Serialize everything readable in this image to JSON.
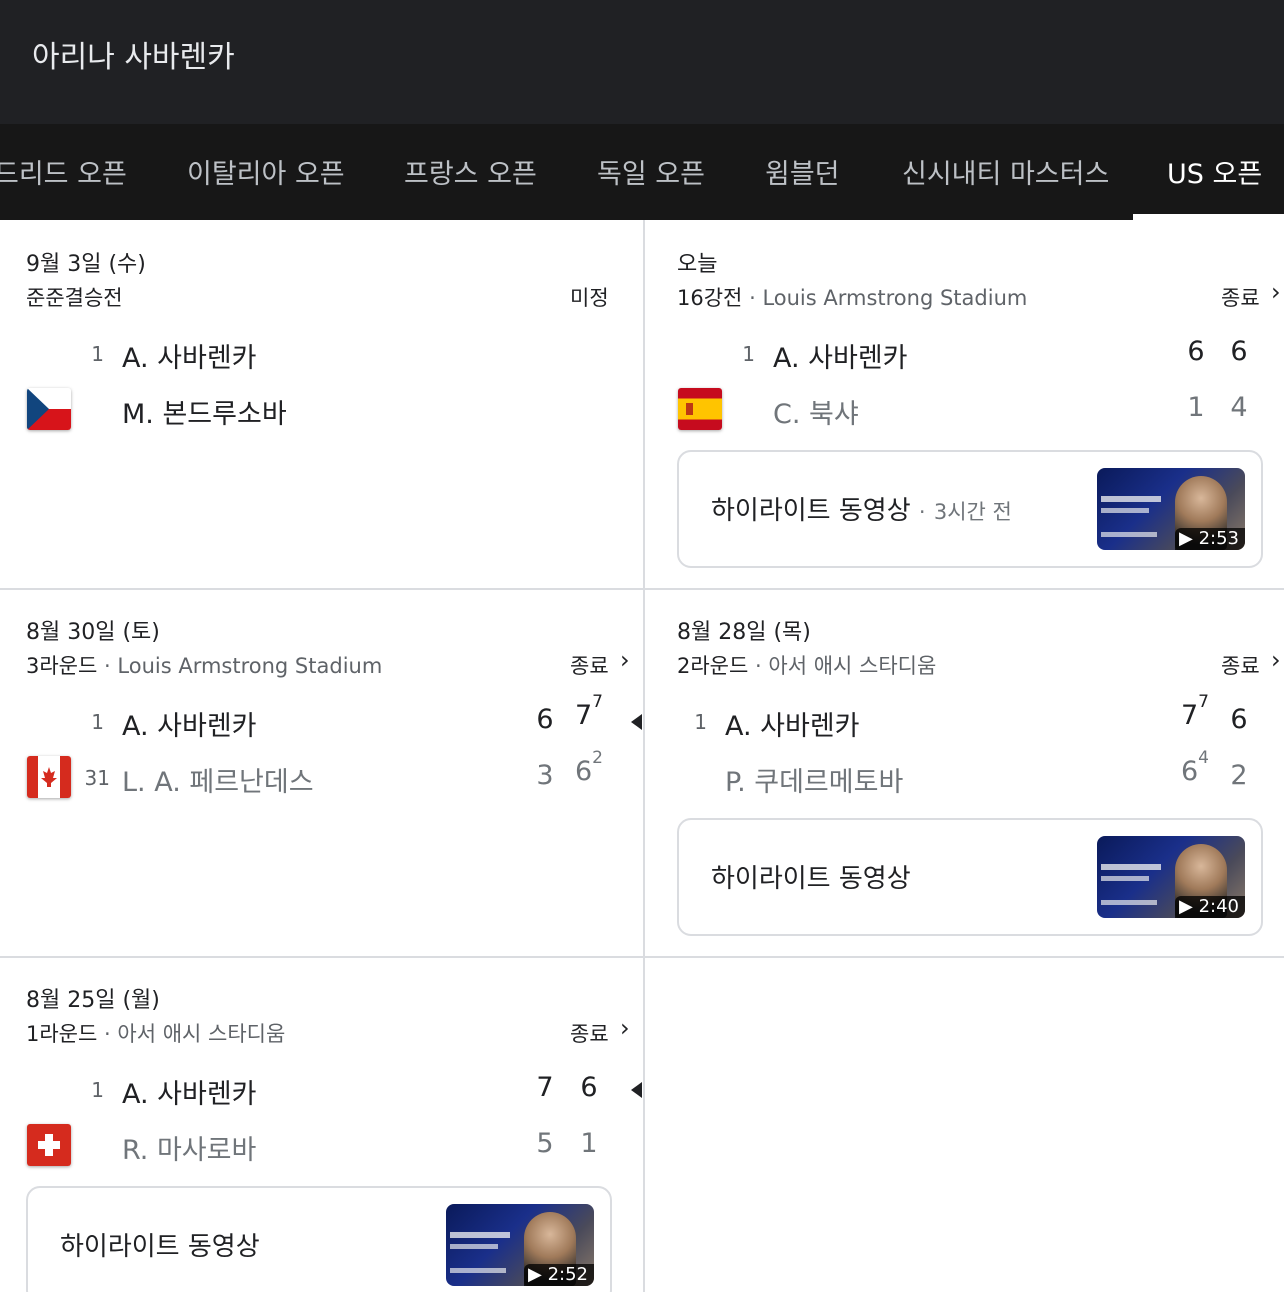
{
  "header": {
    "title": "아리나 사바렌카"
  },
  "tabs": [
    {
      "label": "드리드 오픈"
    },
    {
      "label": "이탈리아 오픈"
    },
    {
      "label": "프랑스 오픈"
    },
    {
      "label": "독일 오픈"
    },
    {
      "label": "윔블던"
    },
    {
      "label": "신시내티 마스터스"
    },
    {
      "label": "US 오픈",
      "active": true
    }
  ],
  "matches": [
    {
      "date": "9월 3일 (수)",
      "round": "준준결승전",
      "venue": "",
      "status": "미정",
      "players": [
        {
          "seed": "1",
          "name": "A. 사바렌카",
          "flag": "",
          "scores": []
        },
        {
          "seed": "",
          "name": "M. 본드루소바",
          "flag": "czech-flag-icon",
          "scores": []
        }
      ]
    },
    {
      "date": "오늘",
      "round": "16강전",
      "venue": "Louis Armstrong Stadium",
      "status": "종료",
      "players": [
        {
          "seed": "1",
          "name": "A. 사바렌카",
          "flag": "",
          "scores": [
            "6",
            "6"
          ]
        },
        {
          "seed": "",
          "name": "C. 북샤",
          "flag": "spain-flag-icon",
          "scores": [
            "1",
            "4"
          ]
        }
      ],
      "highlight": {
        "label": "하이라이트 동영상",
        "time": "3시간 전",
        "duration": "▶ 2:53"
      }
    },
    {
      "date": "8월 30일 (토)",
      "round": "3라운드",
      "venue": "Louis Armstrong Stadium",
      "status": "종료",
      "players": [
        {
          "seed": "1",
          "name": "A. 사바렌카",
          "flag": "",
          "scores": [
            "6",
            "7"
          ],
          "tiebreaks": [
            "",
            "7"
          ]
        },
        {
          "seed": "31",
          "name": "L. A. 페르난데스",
          "flag": "canada-flag-icon",
          "scores": [
            "3",
            "6"
          ],
          "tiebreaks": [
            "",
            "2"
          ]
        }
      ]
    },
    {
      "date": "8월 28일 (목)",
      "round": "2라운드",
      "venue": "아서 애시 스타디움",
      "status": "종료",
      "players": [
        {
          "seed": "1",
          "name": "A. 사바렌카",
          "flag": "",
          "scores": [
            "7",
            "6"
          ],
          "tiebreaks": [
            "7",
            ""
          ]
        },
        {
          "seed": "",
          "name": "P. 쿠데르메토바",
          "flag": "",
          "scores": [
            "6",
            "2"
          ],
          "tiebreaks": [
            "4",
            ""
          ]
        }
      ],
      "highlight": {
        "label": "하이라이트 동영상",
        "time": "",
        "duration": "▶ 2:40"
      }
    },
    {
      "date": "8월 25일 (월)",
      "round": "1라운드",
      "venue": "아서 애시 스타디움",
      "status": "종료",
      "players": [
        {
          "seed": "1",
          "name": "A. 사바렌카",
          "flag": "",
          "scores": [
            "7",
            "6"
          ]
        },
        {
          "seed": "",
          "name": "R. 마사로바",
          "flag": "switzerland-flag-icon",
          "scores": [
            "5",
            "1"
          ]
        }
      ],
      "highlight": {
        "label": "하이라이트 동영상",
        "time": "",
        "duration": "▶ 2:52"
      }
    }
  ],
  "sep": "·",
  "chevron": "›"
}
